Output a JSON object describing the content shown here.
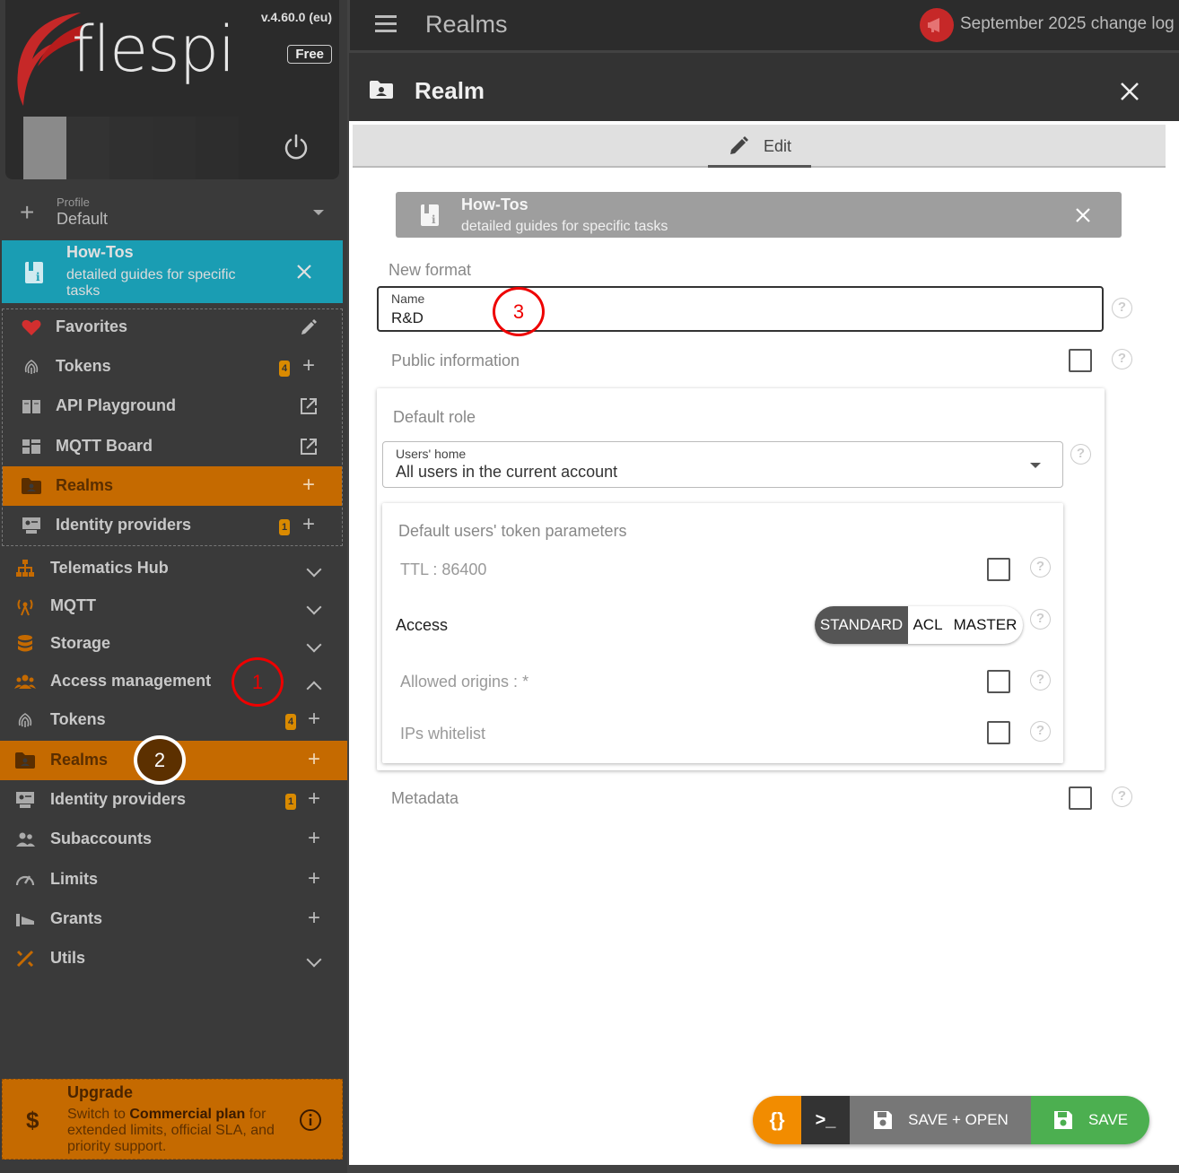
{
  "brand": {
    "logo_text": "flespi",
    "version": "v.4.60.0 (eu)",
    "plan": "Free",
    "tile_colors": [
      "#8a8a8a",
      "#333333",
      "#303030",
      "#2f2f2f",
      "#2d2d2d"
    ],
    "power_icon": "power-icon"
  },
  "profile": {
    "caption": "Profile",
    "value": "Default"
  },
  "howto_side": {
    "title": "How-Tos",
    "subtitle": "detailed guides for specific tasks"
  },
  "favorites": {
    "items": [
      {
        "label": "Favorites",
        "icon": "heart-icon",
        "action": "edit"
      },
      {
        "label": "Tokens",
        "icon": "fingerprint-icon",
        "badge": "4",
        "action": "add"
      },
      {
        "label": "API Playground",
        "icon": "book-icon",
        "action": "open"
      },
      {
        "label": "MQTT Board",
        "icon": "dashboard-icon",
        "action": "open"
      },
      {
        "label": "Realms",
        "icon": "folder-user-icon",
        "action": "add",
        "active": true
      },
      {
        "label": "Identity providers",
        "icon": "identity-icon",
        "badge": "1",
        "action": "add"
      }
    ]
  },
  "nav": {
    "items": [
      {
        "label": "Telematics Hub",
        "icon": "hierarchy-icon",
        "action": "expand"
      },
      {
        "label": "MQTT",
        "icon": "antenna-icon",
        "action": "expand"
      },
      {
        "label": "Storage",
        "icon": "database-icon",
        "action": "expand"
      },
      {
        "label": "Access management",
        "icon": "group-icon",
        "action": "collapse"
      },
      {
        "label": "Tokens",
        "icon": "fingerprint-icon",
        "badge": "4",
        "action": "add"
      },
      {
        "label": "Realms",
        "icon": "folder-user-icon",
        "action": "add",
        "active": true
      },
      {
        "label": "Identity providers",
        "icon": "identity-icon",
        "badge": "1",
        "action": "add"
      },
      {
        "label": "Subaccounts",
        "icon": "people-icon",
        "action": "add"
      },
      {
        "label": "Limits",
        "icon": "gauge-icon",
        "action": "add"
      },
      {
        "label": "Grants",
        "icon": "grant-icon",
        "action": "add"
      },
      {
        "label": "Utils",
        "icon": "tools-icon",
        "action": "expand"
      }
    ]
  },
  "upgrade": {
    "title": "Upgrade",
    "text_pre": "Switch to ",
    "text_bold": "Commercial plan",
    "text_post": " for extended limits, official SLA, and priority support."
  },
  "callouts": {
    "one": "1",
    "two": "2",
    "three": "3"
  },
  "topbar": {
    "title": "Realms",
    "changelog": "September 2025 change log"
  },
  "dialog": {
    "title": "Realm",
    "tab_edit": "Edit",
    "howto": {
      "title": "How-Tos",
      "subtitle": "detailed guides for specific tasks"
    },
    "new_format": "New format",
    "name_caption": "Name",
    "name_value": "R&D",
    "public_info": "Public information",
    "default_role": "Default role",
    "users_home_caption": "Users' home",
    "users_home_value": "All users in the current account",
    "token_params_title": "Default users' token parameters",
    "ttl": "TTL : 86400",
    "access": "Access",
    "access_options": {
      "standard": "STANDARD",
      "acl": "ACL",
      "master": "MASTER"
    },
    "access_selected": "STANDARD",
    "allowed_origins": "Allowed origins : *",
    "ips_whitelist": "IPs whitelist",
    "metadata": "Metadata",
    "help_glyph": "?"
  },
  "actions": {
    "json": "{}",
    "console": ">_",
    "save_open": "SAVE + OPEN",
    "save": "SAVE"
  },
  "colors": {
    "accent_orange": "#c56a00",
    "howto_teal": "#1a9db3",
    "save_green": "#4caf50",
    "json_orange": "#f28c00"
  }
}
